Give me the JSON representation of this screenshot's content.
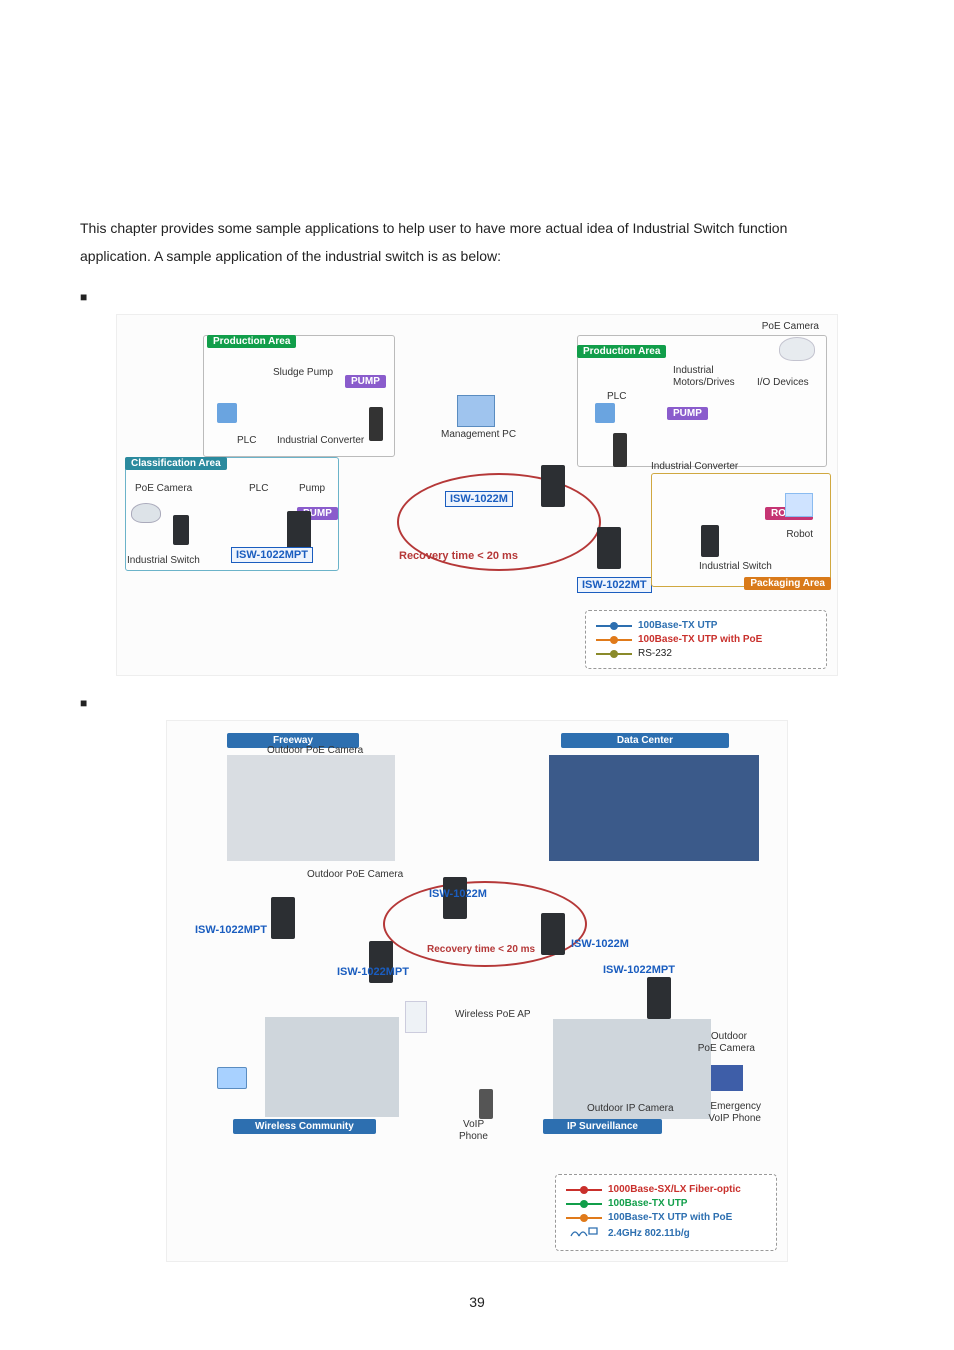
{
  "intro_line1": "This chapter provides some sample applications to help user to have more actual idea of Industrial Switch function",
  "intro_line2": "application. A sample application of the industrial switch is as below:",
  "bullet_glyph": "■",
  "page_number": "39",
  "d1": {
    "poe_camera_top": "PoE Camera",
    "prod_area_left": "Production Area",
    "prod_area_right": "Production Area",
    "sludge_pump": "Sludge Pump",
    "pump": "PUMP",
    "plc_left": "PLC",
    "ind_conv_left": "Industrial  Converter",
    "mgmt_pc": "Management PC",
    "plc_right": "PLC",
    "ind_motors": "Industrial",
    "ind_motors2": "Motors/Drives",
    "io_devices": "I/O Devices",
    "ind_conv_right": "Industrial Converter",
    "class_area": "Classification Area",
    "poe_cam_left": "PoE Camera",
    "plc_mid": "PLC",
    "pump_mid": "Pump",
    "isw1022m": "ISW-1022M",
    "isw1022mpt_left": "ISW-1022MPT",
    "recovery": "Recovery time < 20 ms",
    "ind_switch_left": "Industrial Switch",
    "isw1022mt": "ISW-1022MT",
    "robot_tag": "ROBOT",
    "robot": "Robot",
    "ind_switch_right": "Industrial Switch",
    "pkg_area": "Packaging Area",
    "leg1": "100Base-TX UTP",
    "leg2": "100Base-TX UTP with PoE",
    "leg3": "RS-232"
  },
  "d2": {
    "freeway": "Freeway",
    "data_center": "Data Center",
    "outdoor_poe_cam": "Outdoor PoE Camera",
    "outdoor_poe_cam2": "Outdoor PoE Camera",
    "isw1022m_a": "ISW-1022M",
    "isw1022m_b": "ISW-1022M",
    "isw1022mpt_a": "ISW-1022MPT",
    "isw1022mpt_b": "ISW-1022MPT",
    "isw1022mpt_c": "ISW-1022MPT",
    "recovery": "Recovery time < 20 ms",
    "wireless_ap": "Wireless PoE AP",
    "wireless_comm": "Wireless Community",
    "voip_phone": "VoIP",
    "voip_phone2": "Phone",
    "ip_surv": "IP Surveillance",
    "outdoor_ip_cam": "Outdoor IP Camera",
    "outdoor_poe_cam_right": "Outdoor",
    "outdoor_poe_cam_right2": "PoE Camera",
    "emerg_phone": "Emergency",
    "emerg_phone2": "VoIP Phone",
    "leg1": "1000Base-SX/LX Fiber-optic",
    "leg2": "100Base-TX UTP",
    "leg3": "100Base-TX UTP with PoE",
    "leg4": "2.4GHz 802.11b/g"
  }
}
